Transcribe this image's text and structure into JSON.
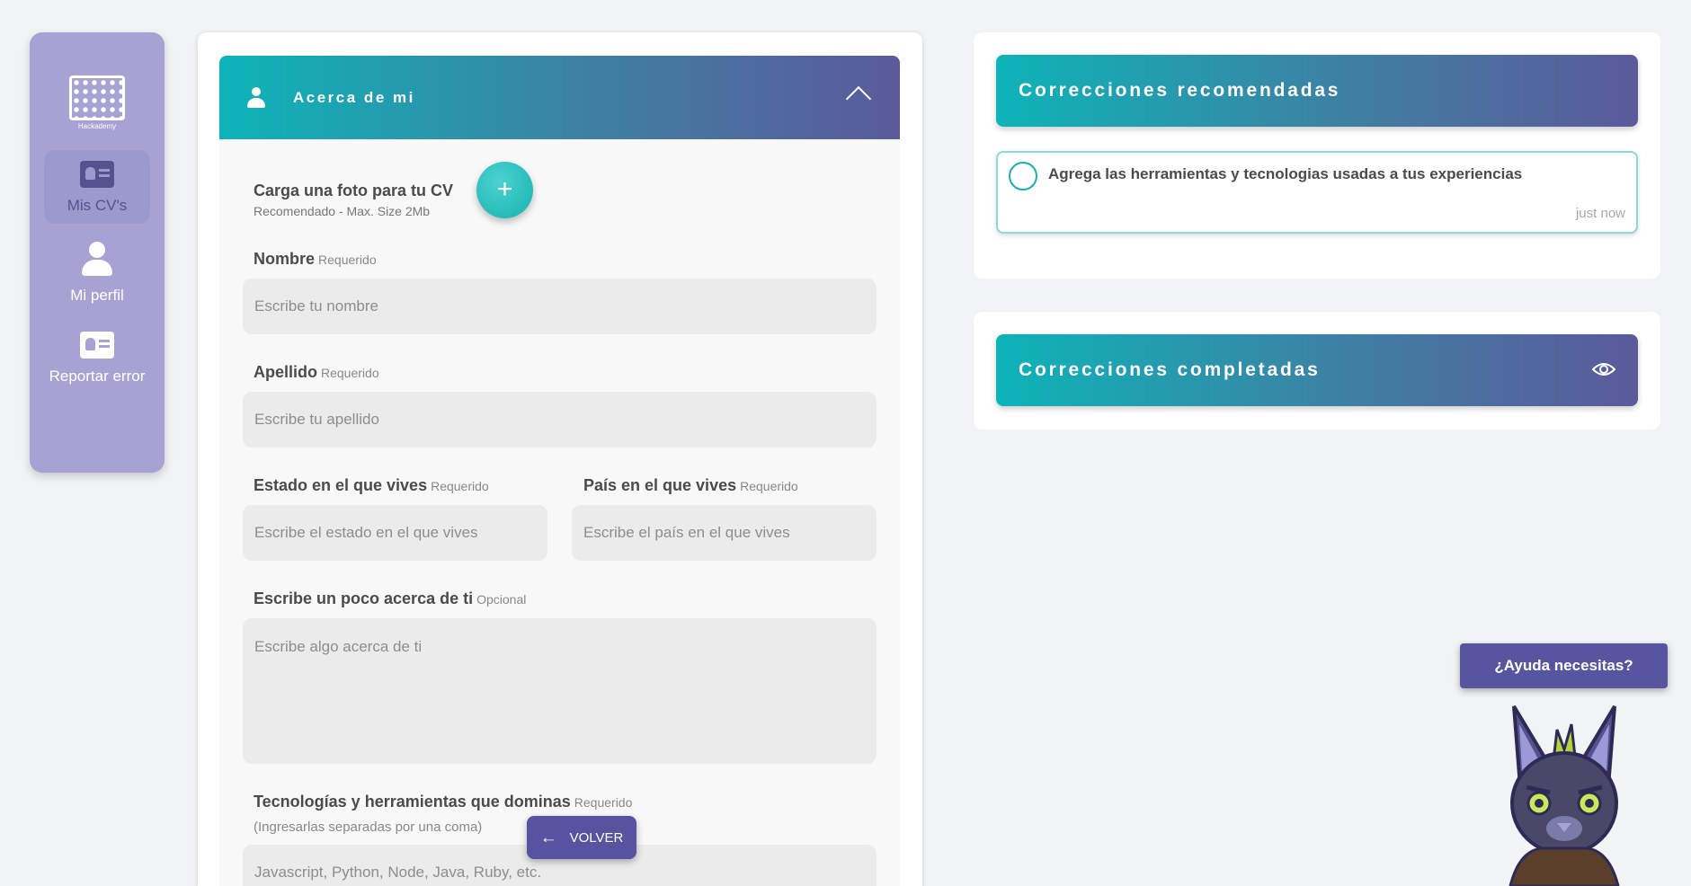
{
  "sidebar": {
    "logo_text": "Hackademy",
    "items": [
      {
        "label": "Mis CV's",
        "icon": "id-card-icon",
        "active": true
      },
      {
        "label": "Mi perfil",
        "icon": "user-icon",
        "active": false
      },
      {
        "label": "Reportar error",
        "icon": "id-card-icon",
        "active": false
      }
    ]
  },
  "form": {
    "section_title": "Acerca de mi",
    "photo": {
      "title": "Carga una foto para tu CV",
      "subtitle": "Recomendado - Max. Size 2Mb",
      "button_label": "+"
    },
    "nombre": {
      "label": "Nombre",
      "tag": "Requerido",
      "placeholder": "Escribe tu nombre"
    },
    "apellido": {
      "label": "Apellido",
      "tag": "Requerido",
      "placeholder": "Escribe tu apellido"
    },
    "estado": {
      "label": "Estado en el que vives",
      "tag": "Requerido",
      "placeholder": "Escribe el estado en el que vives"
    },
    "pais": {
      "label": "País en el que vives",
      "tag": "Requerido",
      "placeholder": "Escribe el país en el que vives"
    },
    "acerca": {
      "label": "Escribe un poco acerca de ti",
      "tag": "Opcional",
      "placeholder": "Escribe algo acerca de ti"
    },
    "tecnologias": {
      "label": "Tecnologías y herramientas que dominas",
      "tag": "Requerido",
      "hint": "(Ingresarlas separadas por una coma)",
      "placeholder": "Javascript, Python, Node, Java, Ruby, etc."
    },
    "back_button": "VOLVER"
  },
  "recommended": {
    "title": "Correcciones recomendadas",
    "items": [
      {
        "text": "Agrega las herramientas y tecnologias usadas a tus experiencias",
        "time": "just now"
      }
    ]
  },
  "completed": {
    "title": "Correcciones completadas"
  },
  "help": {
    "button": "¿Ayuda necesitas?"
  },
  "colors": {
    "sidebar": "#a6a3d4",
    "accent_teal": "#0db4b9",
    "accent_purple": "#5b5a9b",
    "button_purple": "#5753a0"
  }
}
